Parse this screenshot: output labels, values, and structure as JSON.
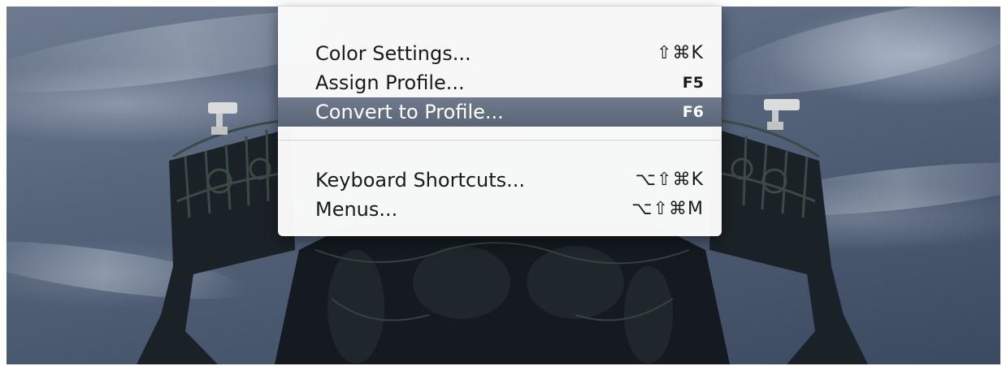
{
  "menu": {
    "items": [
      {
        "label": "Color Settings...",
        "shortcut": "⇧⌘K"
      },
      {
        "label": "Assign Profile...",
        "shortcut": "F5"
      },
      {
        "label": "Convert to Profile...",
        "shortcut": "F6",
        "highlighted": true
      },
      {
        "label": "Keyboard Shortcuts...",
        "shortcut": "⌥⇧⌘K"
      },
      {
        "label": "Menus...",
        "shortcut": "⌥⇧⌘M"
      }
    ]
  },
  "colors": {
    "highlight": "#646f80",
    "menu_background": "#fafafa",
    "sky": "#56647b"
  },
  "background": {
    "subject": "ornate-statue-capital-photo"
  }
}
